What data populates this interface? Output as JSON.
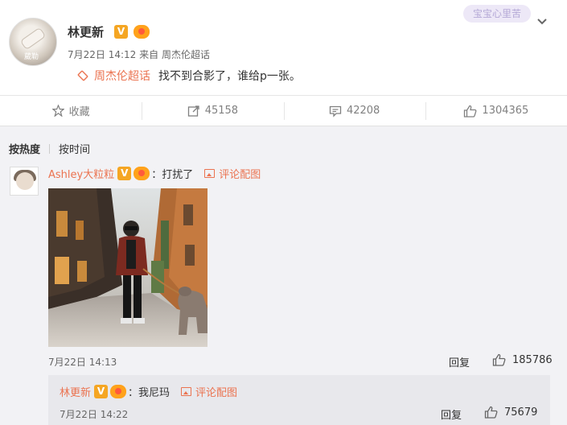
{
  "post": {
    "user_name": "林更新",
    "avatar_text": "葳勒",
    "time": "7月22日 14:12",
    "source_prefix": "来自",
    "source": "周杰伦超话",
    "topic": "周杰伦超话",
    "text": "找不到合影了，谁给p一张。",
    "watermark": "宝宝心里苦"
  },
  "actions": {
    "favorite_label": "收藏",
    "repost_count": "45158",
    "comment_count": "42208",
    "like_count": "1304365"
  },
  "comments": {
    "sort_hot": "按热度",
    "sort_time": "按时间",
    "top": {
      "user": "Ashley大粒粒",
      "text": "：打扰了",
      "image_link": "评论配图",
      "time": "7月22日 14:13",
      "reply_label": "回复",
      "like_count": "185786"
    },
    "sub": {
      "user": "林更新",
      "text": "：我尼玛",
      "image_link": "评论配图",
      "time": "7月22日 14:22",
      "reply_label": "回复",
      "like_count": "75679"
    }
  },
  "colors": {
    "accent": "#eb7350",
    "badge": "#f5a623",
    "background_comments": "#f2f2f5"
  }
}
